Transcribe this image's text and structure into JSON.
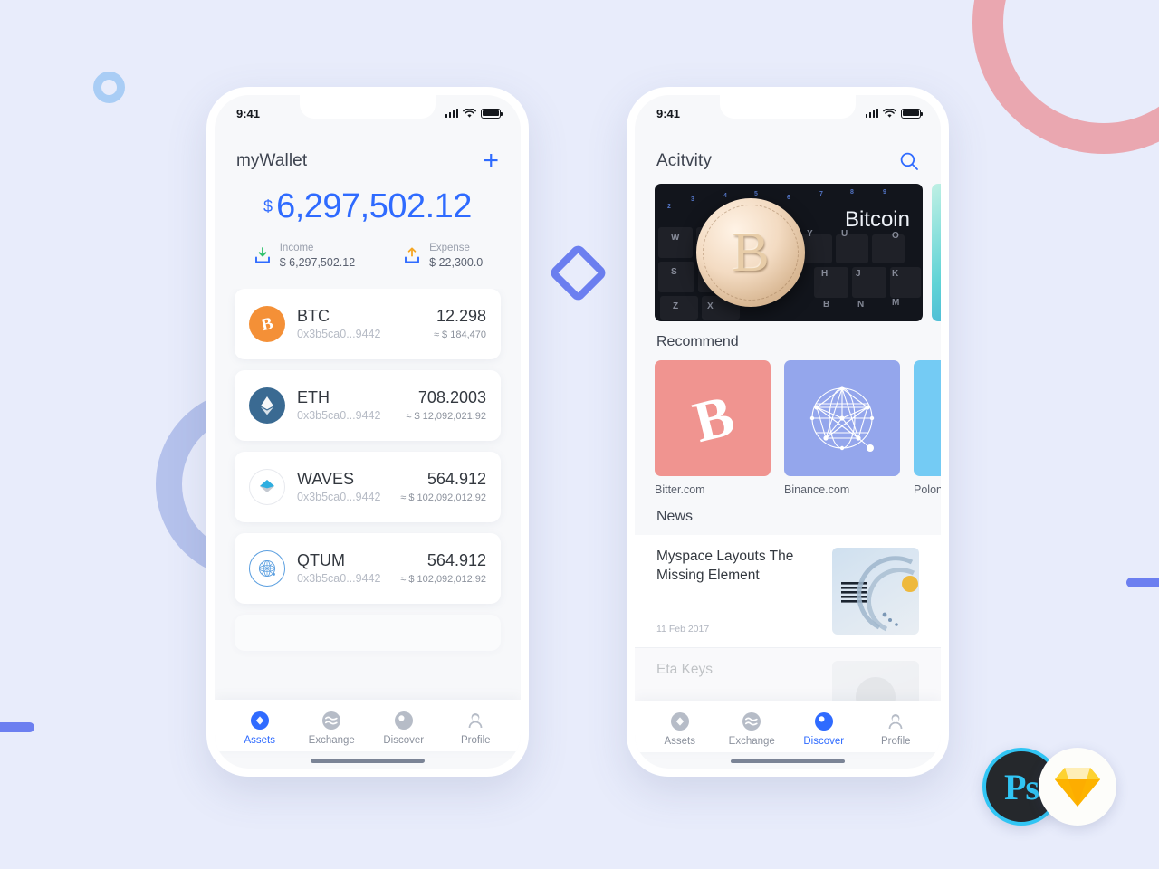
{
  "background": {
    "canvas_color": "#e8ecfb",
    "decorations": [
      {
        "name": "pink-ring-arc",
        "color": "#eaa7b0"
      },
      {
        "name": "small-blue-donut",
        "color": "#a9cdf5"
      },
      {
        "name": "large-periwinkle-ring",
        "color": "#b5c2ec"
      },
      {
        "name": "blue-diamond-outline",
        "color": "#6c7ff0"
      },
      {
        "name": "left-edge-bar",
        "color": "#6c7ff0"
      },
      {
        "name": "right-edge-bar",
        "color": "#6c7ff0"
      }
    ]
  },
  "badges": {
    "photoshop_label": "Ps",
    "photoshop_accent": "#31c5f4",
    "sketch_label": "sketch-diamond-icon",
    "sketch_accent": "#f7a600"
  },
  "wallet_screen": {
    "status_bar": {
      "time": "9:41"
    },
    "header": {
      "title": "myWallet",
      "add_label": "+"
    },
    "balance": {
      "currency_symbol": "$",
      "amount": "6,297,502.12",
      "accent_color": "#2f6bff",
      "income": {
        "label": "Income",
        "value": "$ 6,297,502.12",
        "arrow_color": "#2ec16b"
      },
      "expense": {
        "label": "Expense",
        "value": "$ 22,300.0",
        "arrow_color": "#f5a623"
      }
    },
    "assets": [
      {
        "symbol": "BTC",
        "address": "0x3b5ca0...9442",
        "amount": "12.298",
        "fiat": "≈ $ 184,470",
        "icon": "bitcoin-icon",
        "color": "#f49037"
      },
      {
        "symbol": "ETH",
        "address": "0x3b5ca0...9442",
        "amount": "708.2003",
        "fiat": "≈ $ 12,092,021.92",
        "icon": "ethereum-icon",
        "color": "#3a6a92"
      },
      {
        "symbol": "WAVES",
        "address": "0x3b5ca0...9442",
        "amount": "564.912",
        "fiat": "≈ $ 102,092,012.92",
        "icon": "waves-icon",
        "color": "#ffffff"
      },
      {
        "symbol": "QTUM",
        "address": "0x3b5ca0...9442",
        "amount": "564.912",
        "fiat": "≈ $ 102,092,012.92",
        "icon": "qtum-icon",
        "color": "#ffffff"
      }
    ],
    "tabs": [
      {
        "label": "Assets",
        "icon": "diamond-icon",
        "active": true
      },
      {
        "label": "Exchange",
        "icon": "waves-icon",
        "active": false
      },
      {
        "label": "Discover",
        "icon": "compass-icon",
        "active": false
      },
      {
        "label": "Profile",
        "icon": "person-icon",
        "active": false
      }
    ]
  },
  "activity_screen": {
    "status_bar": {
      "time": "9:41"
    },
    "header": {
      "title": "Acitvity",
      "search_icon": "search-icon"
    },
    "banners": [
      {
        "caption": "Bitcoin",
        "alt": "bitcoin coin on keyboard"
      },
      {
        "caption": "",
        "alt": "teal abstract image"
      }
    ],
    "recommend": {
      "section_title": "Recommend",
      "items": [
        {
          "label": "Bitter.com",
          "color": "#f09490",
          "icon": "bitcoin-icon"
        },
        {
          "label": "Binance.com",
          "color": "#94a6ec",
          "icon": "network-globe-icon"
        },
        {
          "label": "Polonie",
          "color": "#74cbf4",
          "icon": "sparkle-icon"
        }
      ]
    },
    "news": {
      "section_title": "News",
      "items": [
        {
          "title": "Myspace Layouts The Missing Element",
          "date": "11 Feb 2017",
          "thumb": "ibm-logo-thumb"
        },
        {
          "title": "Eta Keys",
          "date": "",
          "thumb": "avatar-thumb"
        }
      ]
    },
    "tabs": [
      {
        "label": "Assets",
        "icon": "diamond-icon",
        "active": false
      },
      {
        "label": "Exchange",
        "icon": "waves-icon",
        "active": false
      },
      {
        "label": "Discover",
        "icon": "compass-icon",
        "active": true
      },
      {
        "label": "Profile",
        "icon": "person-icon",
        "active": false
      }
    ]
  }
}
